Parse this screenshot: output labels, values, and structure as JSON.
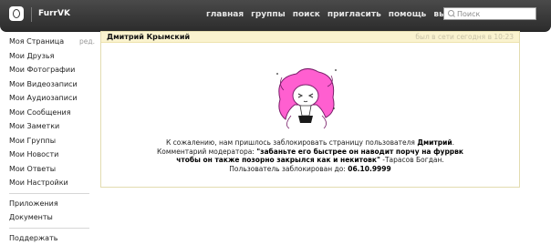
{
  "header": {
    "brand": "FurrVK",
    "nav": [
      "главная",
      "группы",
      "поиск",
      "пригласить",
      "помощь",
      "выйти"
    ],
    "search_placeholder": "Поиск"
  },
  "sidebar": {
    "items": [
      {
        "label": "Моя Страница",
        "edit": "ред."
      },
      {
        "label": "Мои Друзья"
      },
      {
        "label": "Мои Фотографии"
      },
      {
        "label": "Мои Видеозаписи"
      },
      {
        "label": "Мои Аудиозаписи"
      },
      {
        "label": "Мои Сообщения"
      },
      {
        "label": "Мои Заметки"
      },
      {
        "label": "Мои Группы"
      },
      {
        "label": "Мои Новости"
      },
      {
        "label": "Мои Ответы"
      },
      {
        "label": "Мои Настройки"
      }
    ],
    "extra": [
      "Приложения",
      "Документы"
    ],
    "support": "Поддержать"
  },
  "profile": {
    "name": "Дмитрий Крымский",
    "status": "был в сети сегодня в 10:23",
    "message": {
      "line1_prefix": "К сожалению, нам пришлось заблокировать страницу пользователя ",
      "line1_user": "Дмитрий",
      "line1_suffix": ".",
      "line2_prefix": "Комментарий модератора: ",
      "comment": "\"забаньте его быстрее он наводит порчу на фуррвк чтобы он также позорно закрылся как и некитовк\"",
      "comment_author": " -Тарасов Богдан.",
      "line3_prefix": "Пользователь заблокирован до: ",
      "until": "06.10.9999"
    }
  },
  "colors": {
    "header_bg": "#333333",
    "profile_head_bg": "#faf3cf",
    "avatar_hair": "#ff5fd0"
  }
}
